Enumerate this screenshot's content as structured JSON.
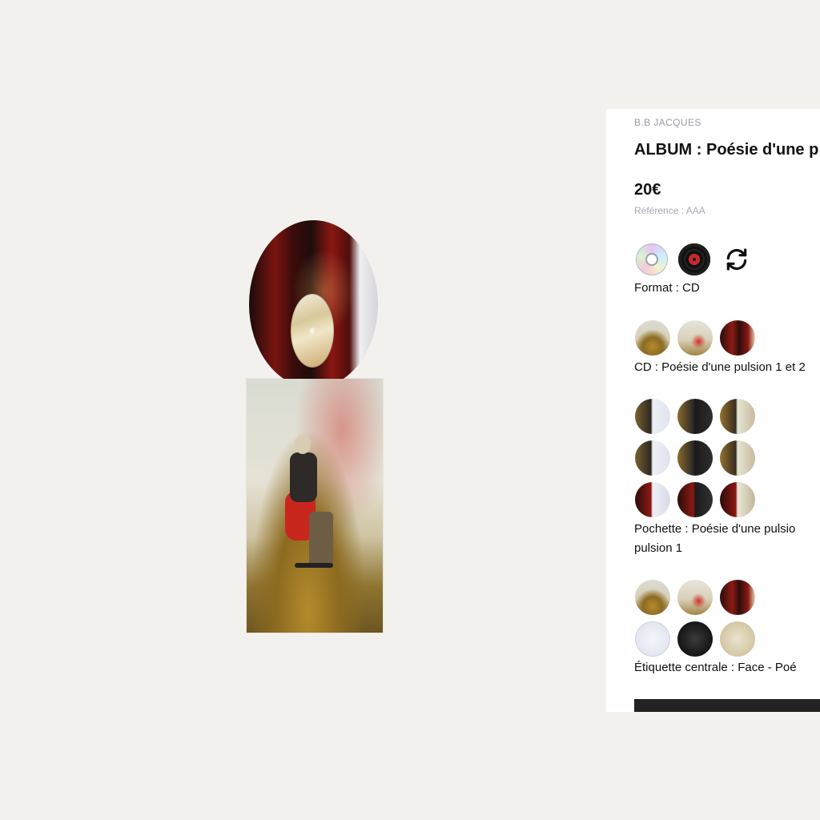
{
  "product": {
    "brand": "B.B JACQUES",
    "title": "ALBUM : Poésie d'une p",
    "price": "20€",
    "reference": "Référence : AAA"
  },
  "options": {
    "format": {
      "label": "Format : CD",
      "selected": "cd",
      "swatches": [
        "cd-icon",
        "vinyl-icon",
        "refresh-icon"
      ]
    },
    "cd": {
      "label": "CD : Poésie d'une pulsion 1 et 2"
    },
    "pochette": {
      "label_line1": "Pochette : Poésie d'une pulsio",
      "label_line2": "pulsion 1"
    },
    "etiquette": {
      "label": "Étiquette centrale : Face - Poé"
    }
  },
  "colors": {
    "background": "#f3f1ed",
    "panel": "#ffffff",
    "cta": "#222222",
    "muted_text": "#9a9aa6"
  }
}
